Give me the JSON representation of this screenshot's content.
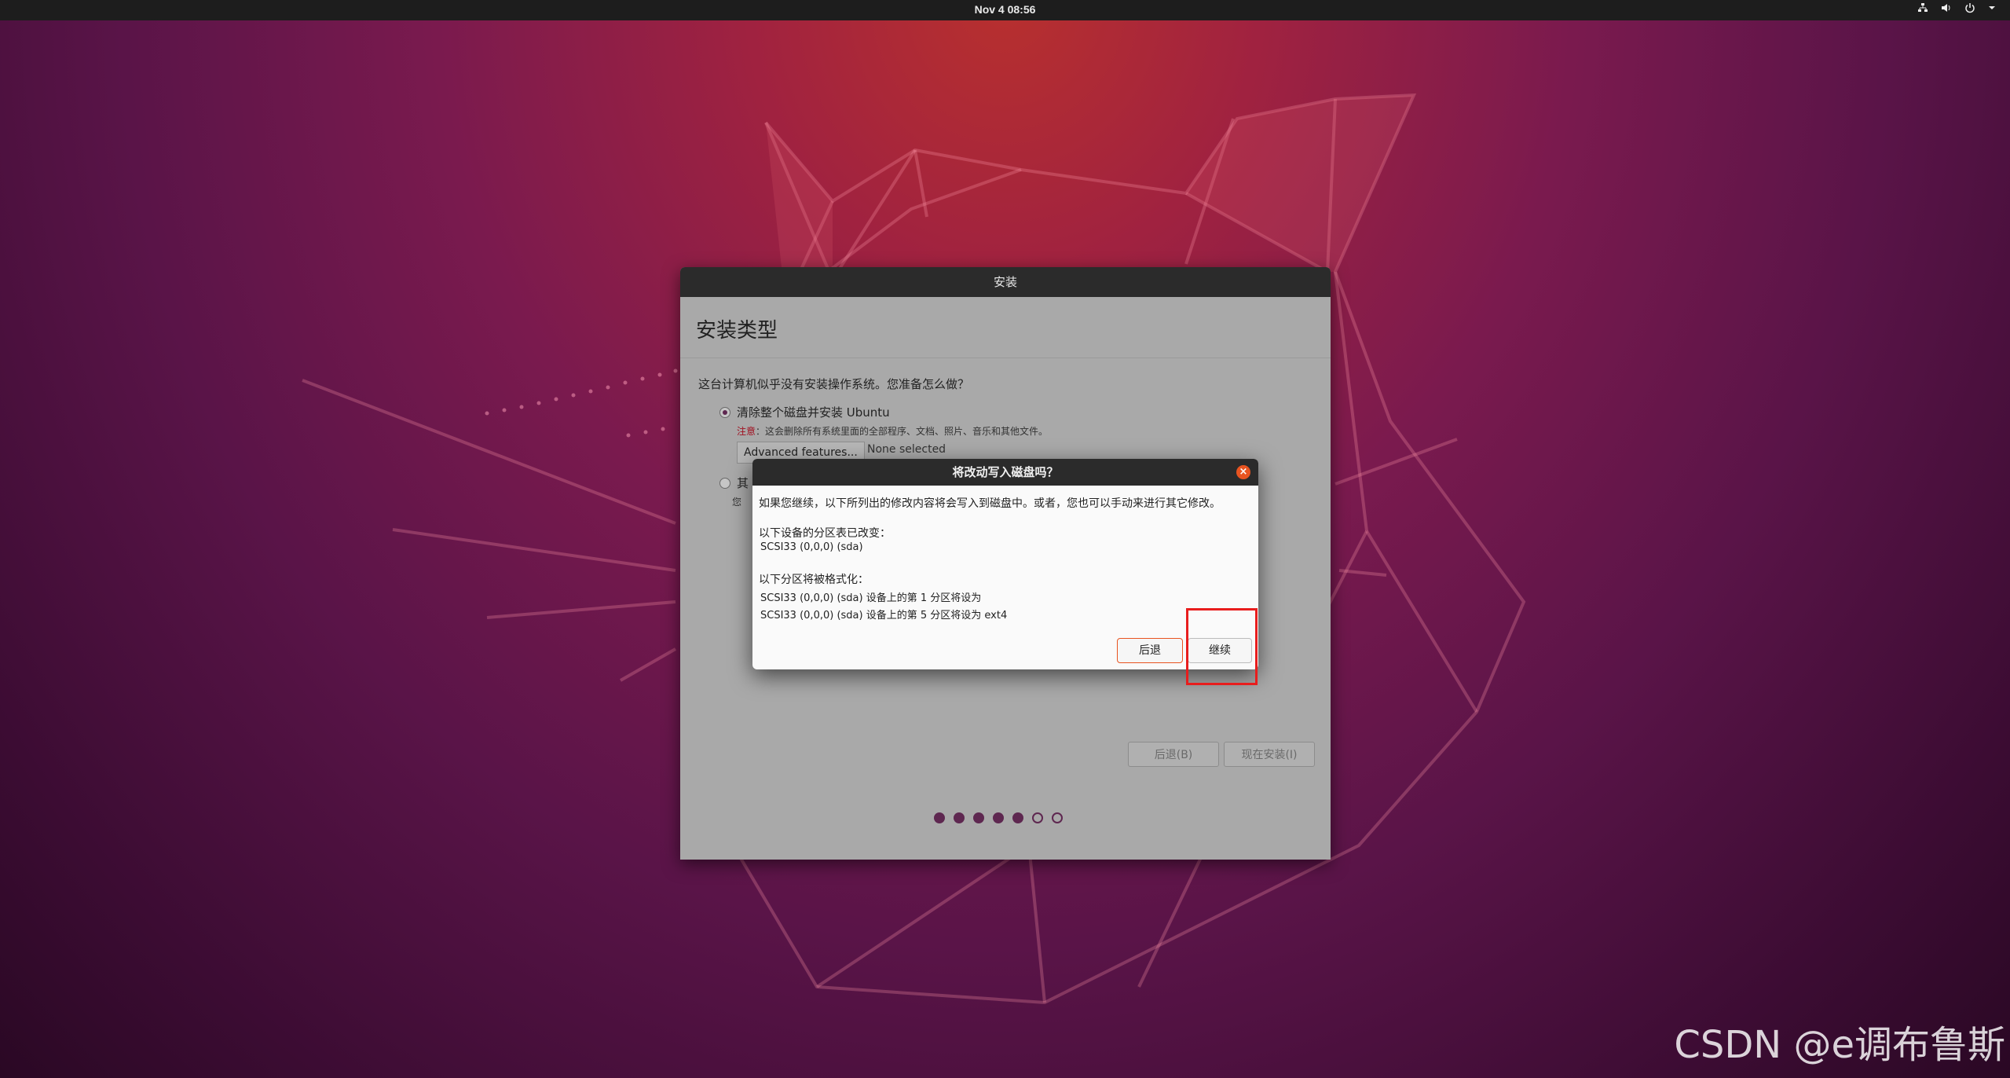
{
  "topbar": {
    "datetime": "Nov 4  08:56",
    "icons": [
      "network-icon",
      "volume-icon",
      "power-icon",
      "menu-arrow-icon"
    ]
  },
  "installer": {
    "title": "安装",
    "heading": "安装类型",
    "question": "这台计算机似乎没有安装操作系统。您准备怎么做？",
    "option_erase": {
      "label": "清除整个磁盘并安装 Ubuntu",
      "note_warn": "注意",
      "note_text": "：这会删除所有系统里面的全部程序、文档、照片、音乐和其他文件。",
      "selected": true
    },
    "advanced_button": "Advanced features...",
    "advanced_status": "None selected",
    "option_other": {
      "label": "其",
      "desc": "您",
      "selected": false
    },
    "back_button": "后退(B)",
    "install_button": "现在安装(I)",
    "progress": {
      "total": 7,
      "completed": 5
    }
  },
  "dialog": {
    "title": "将改动写入磁盘吗？",
    "intro": "如果您继续，以下所列出的修改内容将会写入到磁盘中。或者，您也可以手动来进行其它修改。",
    "partition_table_heading": "以下设备的分区表已改变：",
    "partition_table_device": "SCSI33 (0,0,0) (sda)",
    "format_heading": "以下分区将被格式化：",
    "format_items": [
      "SCSI33 (0,0,0) (sda) 设备上的第 1 分区将设为",
      "SCSI33 (0,0,0) (sda) 设备上的第 5 分区将设为 ext4"
    ],
    "back_button": "后退",
    "continue_button": "继续"
  },
  "watermark": "CSDN @e调布鲁斯",
  "colors": {
    "accent": "#e95420",
    "aubergine": "#5e2750",
    "highlight": "#e81d1d"
  }
}
